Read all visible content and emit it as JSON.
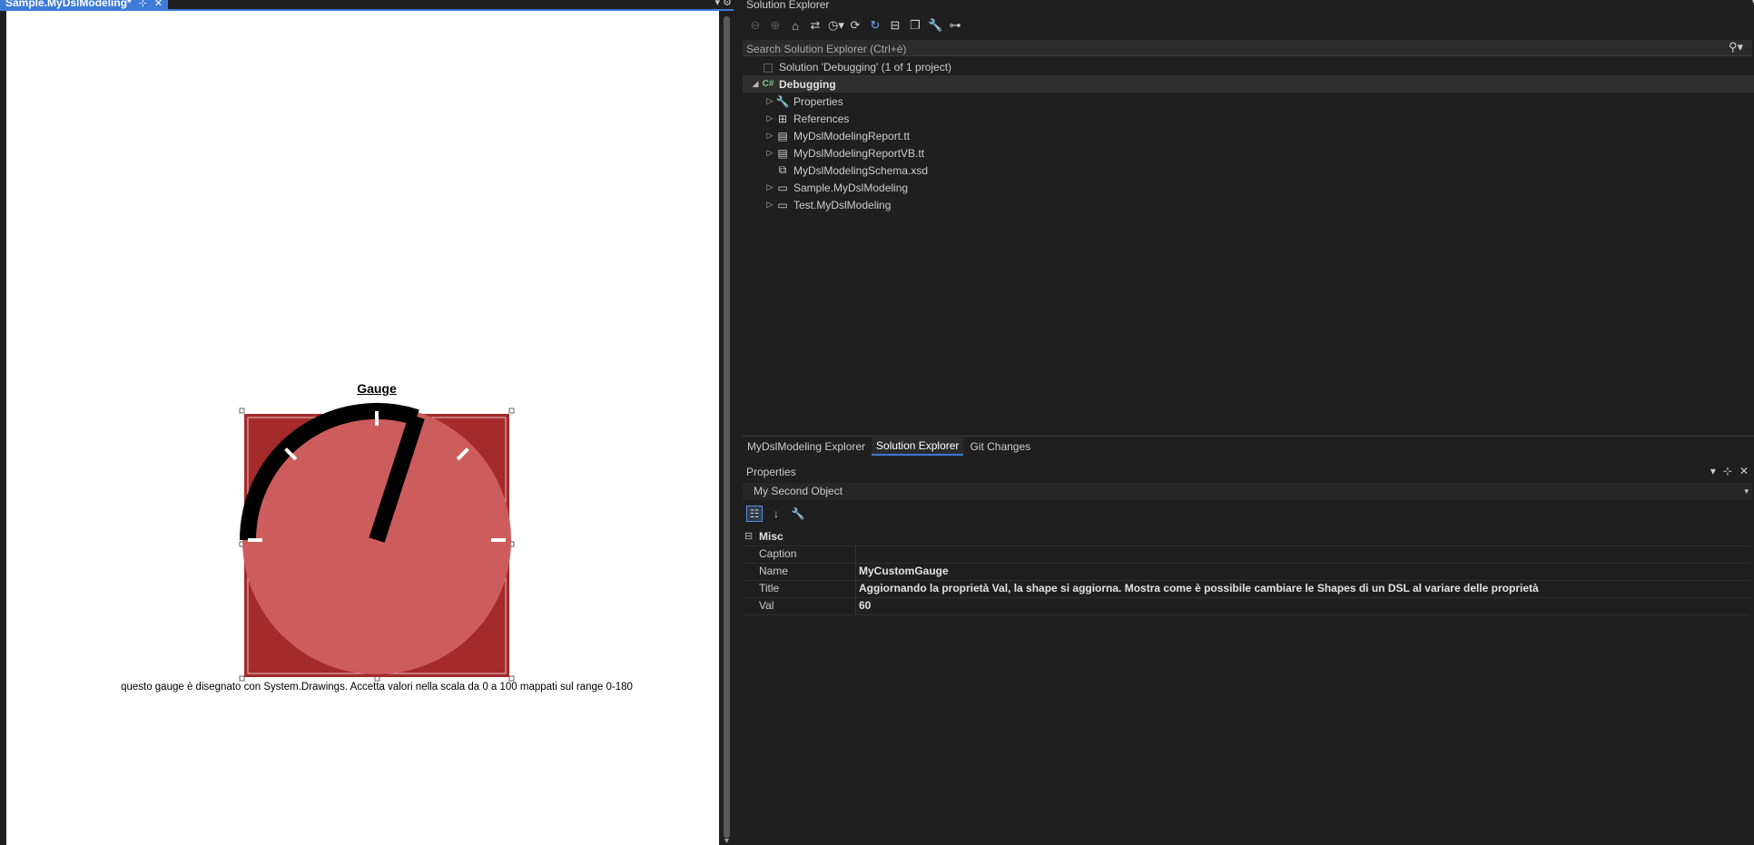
{
  "document": {
    "tab_title": "Sample.MyDslModeling*",
    "pin_icon": "pin-icon",
    "close_icon": "close-icon",
    "gauge": {
      "title": "Gauge",
      "value": 60,
      "scale_min": 0,
      "scale_max": 100,
      "caption": "questo gauge è disegnato con System.Drawings. Accetta valori nella scala da 0 a 100 mappati sul range 0-180",
      "colors": {
        "background": "#a52a2a",
        "dial": "#cd5c5c",
        "needle": "#000000",
        "ticks": "#ffffff"
      }
    }
  },
  "solution_explorer": {
    "title": "Solution Explorer",
    "search_placeholder": "Search Solution Explorer (Ctrl+è)",
    "items": [
      {
        "label": "Solution 'Debugging' (1 of 1 project)",
        "icon": "solution-icon"
      },
      {
        "label": "Debugging",
        "icon": "csharp-project-icon"
      },
      {
        "label": "Properties",
        "icon": "wrench-icon"
      },
      {
        "label": "References",
        "icon": "references-icon"
      },
      {
        "label": "MyDslModelingReport.tt",
        "icon": "file-icon"
      },
      {
        "label": "MyDslModelingReportVB.tt",
        "icon": "file-icon"
      },
      {
        "label": "MyDslModelingSchema.xsd",
        "icon": "xsd-file-icon"
      },
      {
        "label": "Sample.MyDslModeling",
        "icon": "file-icon"
      },
      {
        "label": "Test.MyDslModeling",
        "icon": "file-icon"
      }
    ]
  },
  "tool_tabs": [
    {
      "label": "MyDslModeling Explorer"
    },
    {
      "label": "Solution Explorer"
    },
    {
      "label": "Git Changes"
    }
  ],
  "properties": {
    "title": "Properties",
    "object": "My Second Object",
    "category": "Misc",
    "rows": [
      {
        "key": "Caption",
        "value": ""
      },
      {
        "key": "Name",
        "value": "MyCustomGauge"
      },
      {
        "key": "Title",
        "value": "Aggiornando la proprietà Val, la shape si aggiorna. Mostra come è possibile cambiare le Shapes di un DSL al variare delle proprietà"
      },
      {
        "key": "Val",
        "value": "60"
      }
    ]
  }
}
